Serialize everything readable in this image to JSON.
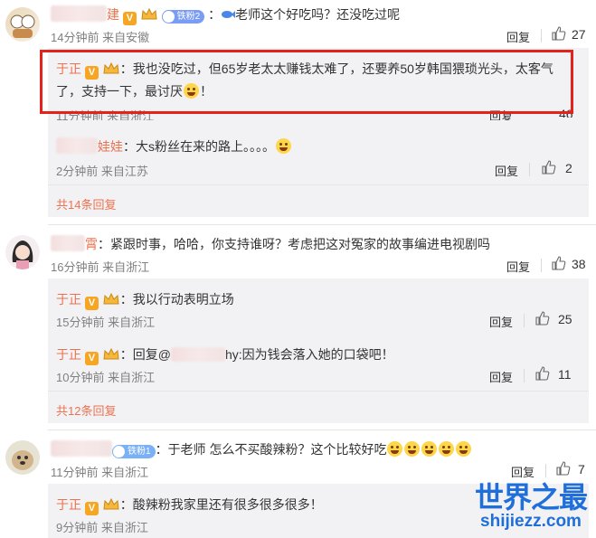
{
  "colors": {
    "accent": "#eb7350",
    "frame": "#e5211c",
    "reply_bg": "#f2f2f5",
    "watermark": "#1e6fd9"
  },
  "comments": [
    {
      "name_suffix": "建",
      "fan_label": "铁粉2",
      "text": "老师这个好吃吗？还没吃过呢",
      "meta": "14分钟前 来自安徽",
      "reply_label": "回复",
      "likes": "27",
      "replies": [
        {
          "name": "于正",
          "text_line1": "：我也没吃过，但65岁老太太赚钱太难了，还要养50岁韩国猥琐光头，太客气",
          "text_line2": "了，支持一下，最讨厌",
          "text_end": "！",
          "meta": "11分钟前 来自浙江",
          "reply_label": "回复",
          "likes": "46"
        },
        {
          "name_suffix": "娃娃",
          "text": "：大s粉丝在来的路上。。。。",
          "meta": "2分钟前 来自江苏",
          "reply_label": "回复",
          "likes": "2"
        }
      ],
      "more": "共14条回复"
    },
    {
      "name_suffix": "霄",
      "text": "：紧跟时事，哈哈，你支持谁呀？考虑把这对冤家的故事编进电视剧吗",
      "meta": "16分钟前 来自浙江",
      "reply_label": "回复",
      "likes": "38",
      "replies": [
        {
          "name": "于正",
          "text": "：我以行动表明立场",
          "meta": "15分钟前 来自浙江",
          "reply_label": "回复",
          "likes": "25"
        },
        {
          "name": "于正",
          "text_prefix": "：回复@",
          "text_suffix": "hy:因为钱会落入她的口袋吧！",
          "meta": "10分钟前 来自浙江",
          "reply_label": "回复",
          "likes": "11"
        }
      ],
      "more": "共12条回复"
    },
    {
      "fan_label": "铁粉1",
      "text": "：于老师 怎么不买酸辣粉？这个比较好吃",
      "meta": "11分钟前 来自浙江",
      "reply_label": "回复",
      "likes": "7",
      "replies": [
        {
          "name": "于正",
          "text": "：酸辣粉我家里还有很多很多很多！",
          "meta": "9分钟前 来自浙江"
        }
      ]
    }
  ],
  "watermark": {
    "line1": "世界之最",
    "line2": "shijiezz.com"
  }
}
